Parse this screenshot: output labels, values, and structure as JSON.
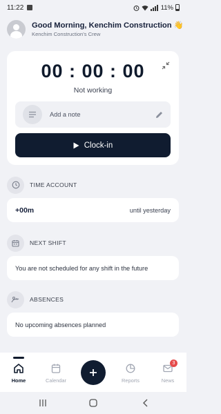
{
  "status_bar": {
    "time": "11:22",
    "battery": "11%"
  },
  "header": {
    "greeting": "Good Morning, Kenchim Construction 👋",
    "crew": "Kenchim Construction's Crew"
  },
  "timer": {
    "display": "00 : 00 : 00",
    "status": "Not working",
    "note_placeholder": "Add a note",
    "clockin_label": "Clock-in"
  },
  "sections": {
    "time_account": {
      "title": "TIME ACCOUNT",
      "value": "+00m",
      "note": "until yesterday"
    },
    "next_shift": {
      "title": "NEXT SHIFT",
      "message": "You are not scheduled for any shift in the future"
    },
    "absences": {
      "title": "ABSENCES",
      "message": "No upcoming absences planned"
    }
  },
  "bottom_nav": {
    "home": "Home",
    "calendar": "Calendar",
    "reports": "Reports",
    "news": "News",
    "news_badge": "3"
  },
  "colors": {
    "primary": "#101c30",
    "background": "#f1f2f6",
    "badge": "#e54b4b"
  }
}
